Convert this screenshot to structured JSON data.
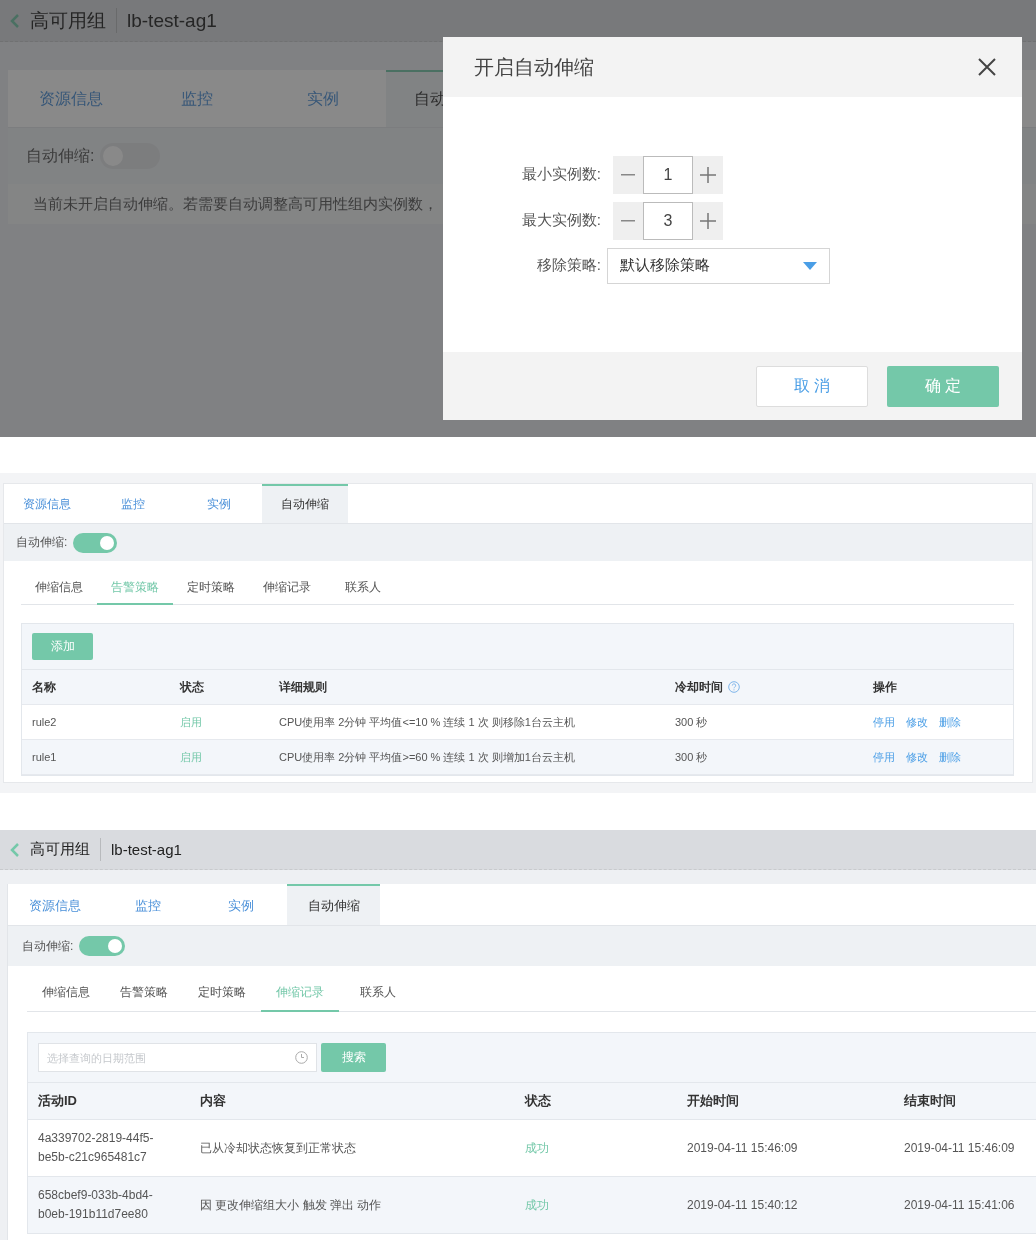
{
  "screen_1": {
    "header": {
      "title": "高可用组",
      "name": "lb-test-ag1"
    },
    "tabs": [
      {
        "label": "资源信息",
        "selected": false
      },
      {
        "label": "监控",
        "selected": false
      },
      {
        "label": "实例",
        "selected": false
      },
      {
        "label": "自动",
        "selected": true
      }
    ],
    "autoscale": {
      "label": "自动伸缩:",
      "on": false
    },
    "notice": "当前未开启自动伸缩。若需要自动调整高可用性组内实例数，",
    "dialog": {
      "title": "开启自动伸缩",
      "fields": [
        {
          "kind": "stepper",
          "label": "最小实例数:",
          "value": "1"
        },
        {
          "kind": "stepper",
          "label": "最大实例数:",
          "value": "3"
        },
        {
          "kind": "select",
          "label": "移除策略:",
          "value": "默认移除策略"
        }
      ],
      "buttons": [
        {
          "label": "取 消",
          "kind": "secondary"
        },
        {
          "label": "确 定",
          "kind": "primary"
        }
      ]
    }
  },
  "screen_2": {
    "tabs": [
      {
        "label": "资源信息",
        "selected": false
      },
      {
        "label": "监控",
        "selected": false
      },
      {
        "label": "实例",
        "selected": false
      },
      {
        "label": "自动伸缩",
        "selected": true
      }
    ],
    "autoscale": {
      "label": "自动伸缩:",
      "on": true
    },
    "subtabs": [
      {
        "label": "伸缩信息",
        "selected": false
      },
      {
        "label": "告警策略",
        "selected": true
      },
      {
        "label": "定时策略",
        "selected": false
      },
      {
        "label": "伸缩记录",
        "selected": false
      },
      {
        "label": "联系人",
        "selected": false
      }
    ],
    "add_button": "添加",
    "table": {
      "columns": [
        {
          "label": "名称",
          "help": false
        },
        {
          "label": "状态",
          "help": false
        },
        {
          "label": "详细规则",
          "help": false
        },
        {
          "label": "冷却时间",
          "help": true
        },
        {
          "label": "操作",
          "help": false
        }
      ],
      "rows": [
        {
          "name": "rule2",
          "status": "启用",
          "rule": "CPU使用率 2分钟 平均值<=10 % 连续 1 次 则移除1台云主机",
          "cooldown": "300 秒",
          "actions": [
            "停用",
            "修改",
            "删除"
          ]
        },
        {
          "name": "rule1",
          "status": "启用",
          "rule": "CPU使用率 2分钟 平均值>=60 % 连续 1 次 则增加1台云主机",
          "cooldown": "300 秒",
          "actions": [
            "停用",
            "修改",
            "删除"
          ]
        }
      ]
    }
  },
  "screen_3": {
    "header": {
      "title": "高可用组",
      "name": "lb-test-ag1"
    },
    "tabs": [
      {
        "label": "资源信息",
        "selected": false
      },
      {
        "label": "监控",
        "selected": false
      },
      {
        "label": "实例",
        "selected": false
      },
      {
        "label": "自动伸缩",
        "selected": true
      }
    ],
    "autoscale": {
      "label": "自动伸缩:",
      "on": true
    },
    "subtabs": [
      {
        "label": "伸缩信息",
        "selected": false
      },
      {
        "label": "告警策略",
        "selected": false
      },
      {
        "label": "定时策略",
        "selected": false
      },
      {
        "label": "伸缩记录",
        "selected": true
      },
      {
        "label": "联系人",
        "selected": false
      }
    ],
    "search": {
      "placeholder": "选择查询的日期范围",
      "button": "搜索"
    },
    "table": {
      "columns": [
        "活动ID",
        "内容",
        "状态",
        "开始时间",
        "结束时间"
      ],
      "rows": [
        {
          "id": "4a339702-2819-44f5-be5b-c21c965481c7",
          "content": "已从冷却状态恢复到正常状态",
          "status": "成功",
          "start": "2019-04-11 15:46:09",
          "end": "2019-04-11 15:46:09"
        },
        {
          "id": "658cbef9-033b-4bd4-b0eb-191b11d7ee80",
          "content": "因 更改伸缩组大小 触发 弹出 动作",
          "status": "成功",
          "start": "2019-04-11 15:40:12",
          "end": "2019-04-11 15:41:06"
        }
      ]
    }
  }
}
